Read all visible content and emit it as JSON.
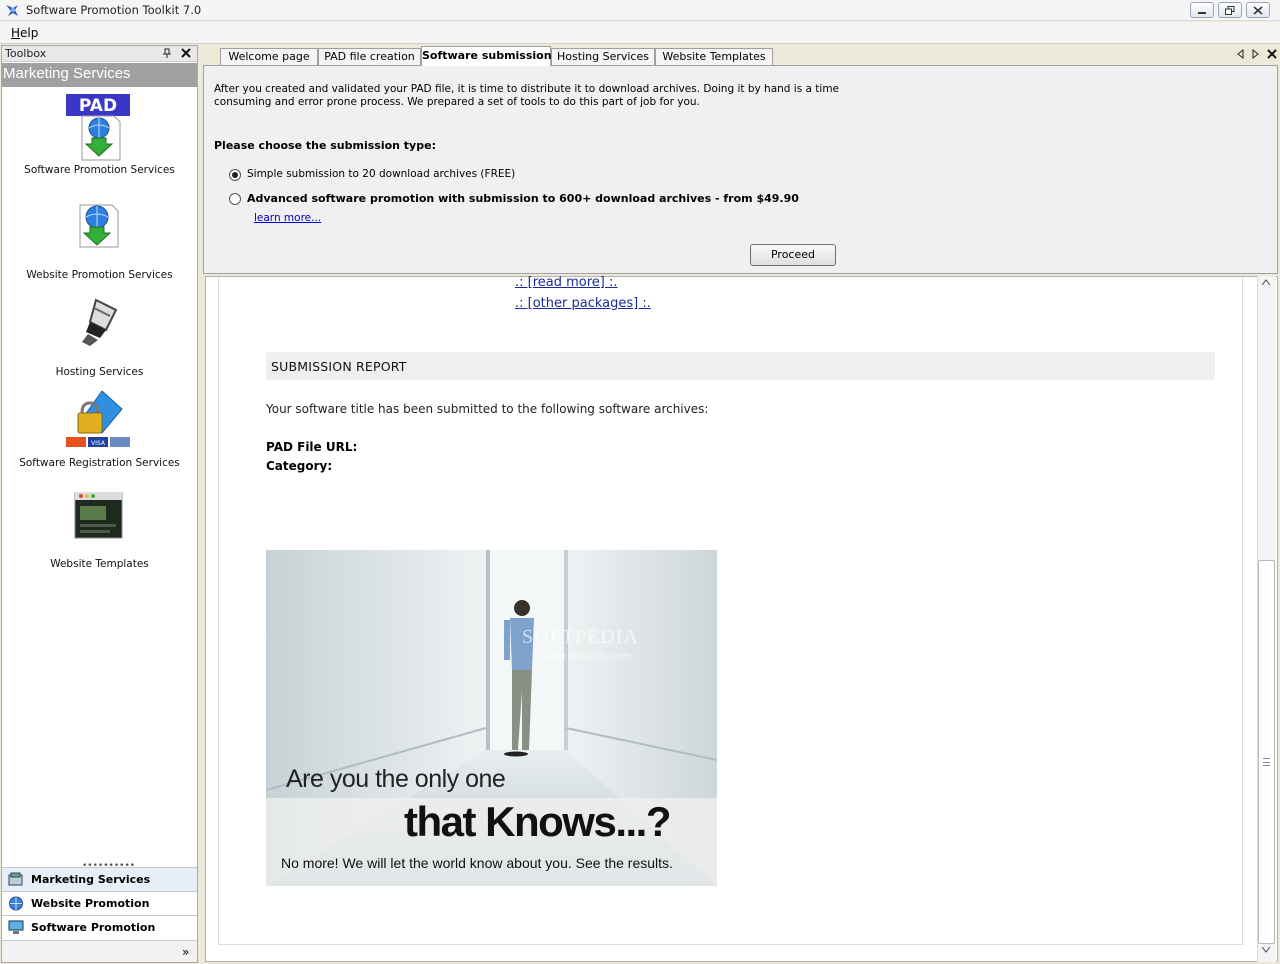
{
  "window": {
    "title": "Software Promotion Toolkit 7.0"
  },
  "menu": {
    "help": "Help"
  },
  "toolbox": {
    "title": "Toolbox",
    "category": "Marketing Services",
    "items": [
      {
        "label": "Software Promotion Services",
        "icon": "pad-download-icon"
      },
      {
        "label": "Website Promotion Services",
        "icon": "globe-download-icon"
      },
      {
        "label": "Hosting Services",
        "icon": "server-plug-icon"
      },
      {
        "label": "Software Registration Services",
        "icon": "lock-cards-icon"
      },
      {
        "label": "Website Templates",
        "icon": "website-template-icon"
      }
    ],
    "splitter": "••••••••••",
    "nav": [
      {
        "label": "Marketing Services",
        "active": true
      },
      {
        "label": "Website Promotion",
        "active": false
      },
      {
        "label": "Software Promotion",
        "active": false
      }
    ],
    "more": "»"
  },
  "tabs": [
    {
      "label": "Welcome page",
      "active": false
    },
    {
      "label": "PAD file creation",
      "active": false
    },
    {
      "label": "Software submission",
      "active": true
    },
    {
      "label": "Hosting Services",
      "active": false
    },
    {
      "label": "Website Templates",
      "active": false
    }
  ],
  "submission": {
    "intro_line1": "After you created and validated your PAD file, it is time to distribute it to download archives. Doing it by hand is a time",
    "intro_line2": "consuming and error prone process. We prepared a set of tools to do this part of job for you.",
    "choose_label": "Please choose the submission type:",
    "option_simple": "Simple submission to 20 download archives (FREE)",
    "option_advanced": "Advanced software promotion with submission to 600+ download archives - from $49.90",
    "selected": "simple",
    "learn_more": "learn more...",
    "proceed": "Proceed"
  },
  "content": {
    "read_more": ".: [read more] :.",
    "other_packages": ".: [other packages] :.",
    "report_title": "SUBMISSION REPORT",
    "report_desc": "Your software title has been submitted to the following software archives:",
    "pad_url_label": "PAD File URL:",
    "category_label": "Category:"
  },
  "banner": {
    "line1": "Are you the only one",
    "line2": "that Knows...?",
    "line3": "No more! We will let the world know about you. See the results.",
    "watermark": "SOFTPEDIA",
    "watermark_url": "www.softpedia.com"
  },
  "colors": {
    "link": "#1a2a99",
    "toolbox_header": "#a0a0a0",
    "panel_bg": "#f0f0f0"
  }
}
